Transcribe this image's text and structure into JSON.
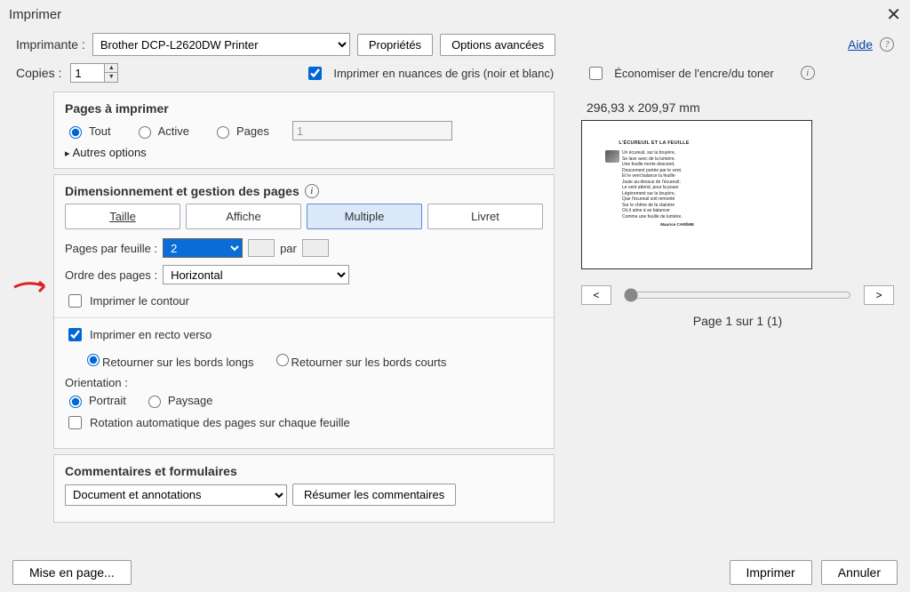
{
  "title": "Imprimer",
  "help_label": "Aide",
  "printer": {
    "label": "Imprimante :",
    "selected": "Brother DCP-L2620DW Printer",
    "properties_btn": "Propriétés",
    "advanced_btn": "Options avancées"
  },
  "copies": {
    "label": "Copies :",
    "value": "1"
  },
  "grayscale": {
    "label": "Imprimer en nuances de gris (noir et blanc)",
    "checked": true
  },
  "save_ink": {
    "label": "Économiser de l'encre/du toner",
    "checked": false
  },
  "pages_to_print": {
    "title": "Pages à imprimer",
    "all": "Tout",
    "active": "Active",
    "pages": "Pages",
    "range": "1",
    "more": "Autres options"
  },
  "sizing": {
    "title": "Dimensionnement et gestion des pages",
    "tabs": {
      "size": "Taille",
      "poster": "Affiche",
      "multiple": "Multiple",
      "booklet": "Livret"
    },
    "ppf_label": "Pages par feuille :",
    "ppf_value": "2",
    "par": "par",
    "order_label": "Ordre des pages :",
    "order_value": "Horizontal",
    "print_border": "Imprimer le contour",
    "duplex": "Imprimer en recto verso",
    "flip_long": "Retourner sur les bords longs",
    "flip_short": "Retourner sur les bords courts",
    "orientation": "Orientation :",
    "portrait": "Portrait",
    "landscape": "Paysage",
    "autorotate": "Rotation automatique des pages sur chaque feuille"
  },
  "comments": {
    "title": "Commentaires et formulaires",
    "selected": "Document et annotations",
    "summarize_btn": "Résumer les commentaires"
  },
  "preview": {
    "dimensions": "296,93 x 209,97 mm",
    "page_indicator": "Page 1 sur 1 (1)",
    "doc_title": "L'ÉCUREUIL ET LA FEUILLE"
  },
  "footer": {
    "page_setup": "Mise en page...",
    "print": "Imprimer",
    "cancel": "Annuler"
  }
}
